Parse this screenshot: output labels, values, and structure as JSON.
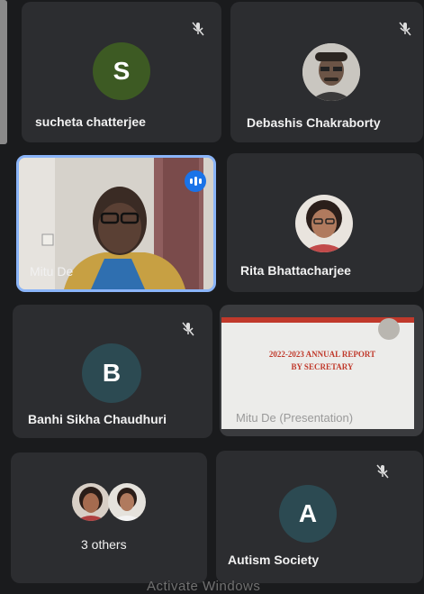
{
  "participants": [
    {
      "name": "sucheta chatterjee",
      "initial": "S",
      "avatar_color": "#3d5a23",
      "muted": true
    },
    {
      "name": "Debashis Chakraborty",
      "muted": true
    },
    {
      "name": "Mitu De",
      "speaking": true
    },
    {
      "name": "Rita Bhattacharjee"
    },
    {
      "name": "Banhi Sikha Chaudhuri",
      "initial": "B",
      "avatar_color": "#2c4a52",
      "muted": true
    },
    {
      "name": "Autism Society",
      "initial": "A",
      "avatar_color": "#2c4a52",
      "muted": true
    }
  ],
  "presentation": {
    "slide_text": "2022-2023 ANNUAL REPORT BY SECRETARY",
    "caption": "Mitu De (Presentation)"
  },
  "others": {
    "label": "3 others"
  },
  "watermark": "Activate Windows",
  "colors": {
    "active_border": "#8ab4f8",
    "slide_text": "#c0392b"
  }
}
